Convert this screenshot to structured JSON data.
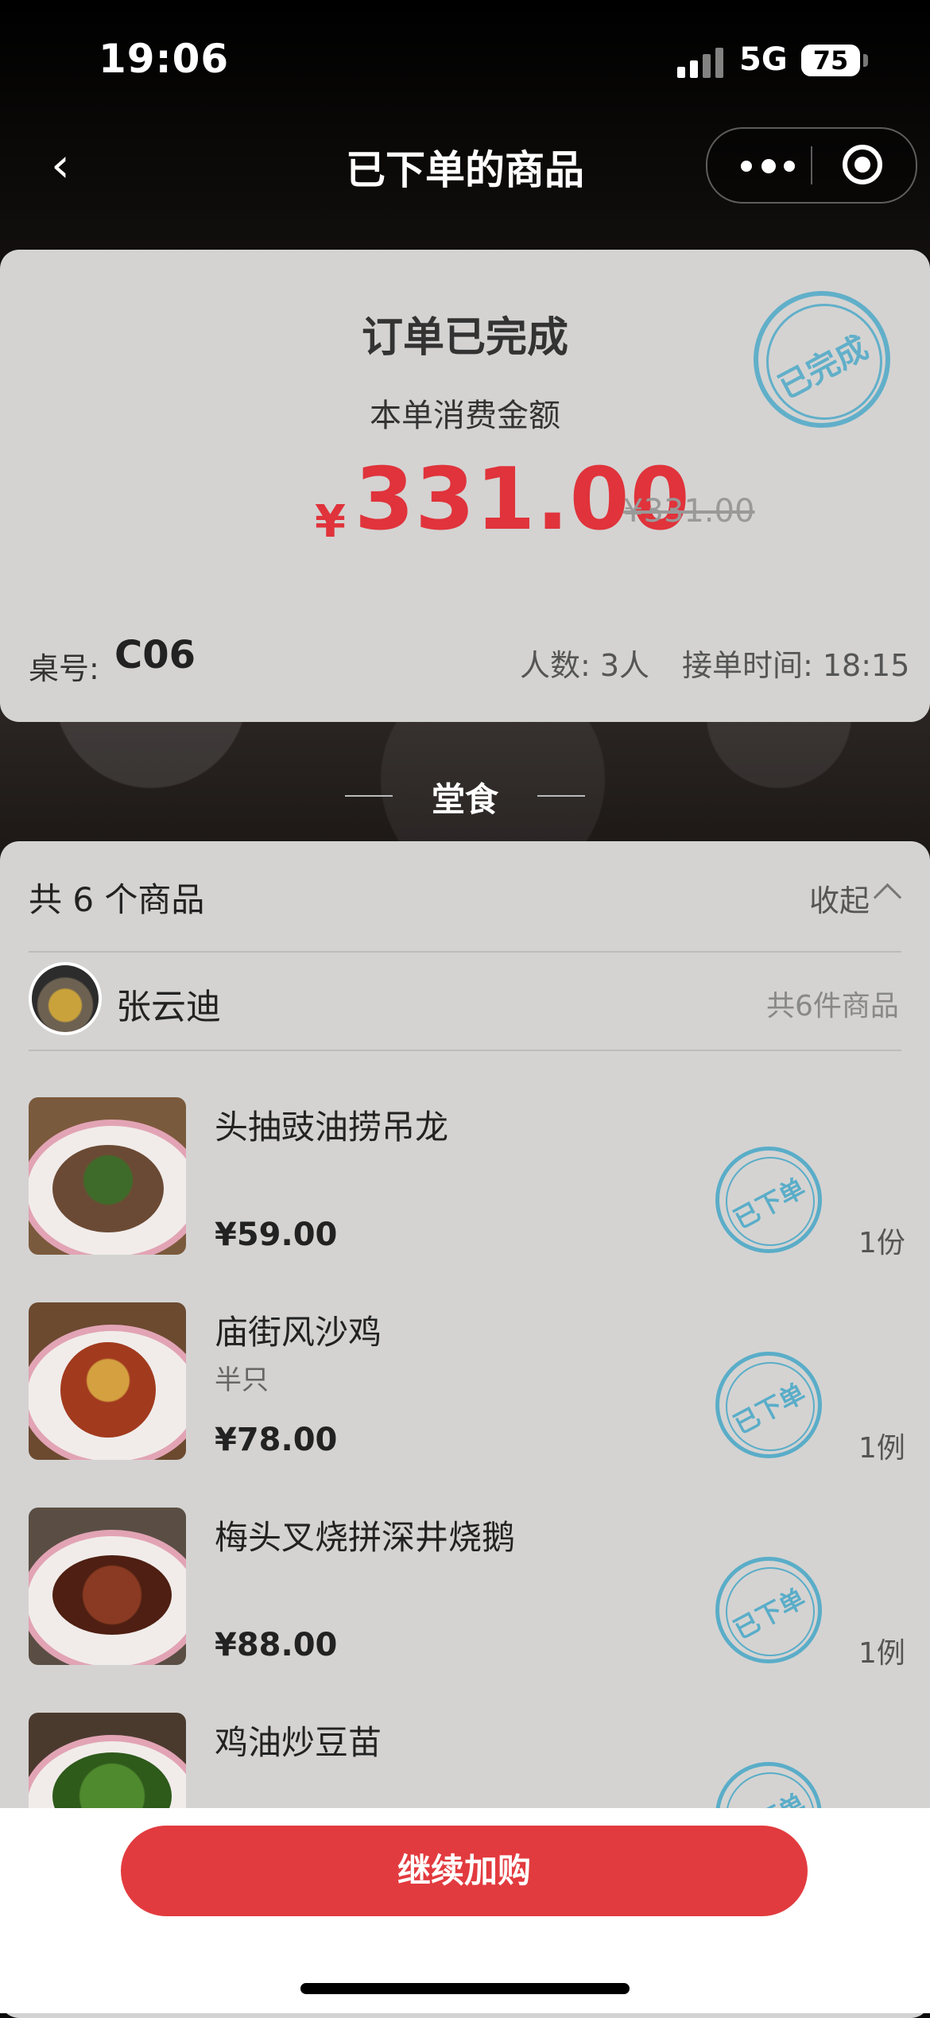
{
  "status_bar": {
    "time": "19:06",
    "network": "5G",
    "battery": "75"
  },
  "nav": {
    "title": "已下单的商品"
  },
  "order": {
    "status": "订单已完成",
    "stamp": "已完成",
    "amount_label": "本单消费金额",
    "currency": "¥",
    "amount": "331.00",
    "original_price": "¥331.00",
    "table_label": "桌号:",
    "table_no": "C06",
    "people": "人数: 3人",
    "accept_time": "接单时间: 18:15"
  },
  "dine_type": "堂食",
  "items_header": {
    "count": "共 6 个商品",
    "collapse": "收起"
  },
  "user": {
    "name": "张云迪",
    "count": "共6件商品"
  },
  "items": [
    {
      "name": "头抽豉油捞吊龙",
      "spec": "",
      "price": "¥59.00",
      "qty": "1份",
      "stamp": "已下单"
    },
    {
      "name": "庙街风沙鸡",
      "spec": "半只",
      "price": "¥78.00",
      "qty": "1例",
      "stamp": "已下单"
    },
    {
      "name": "梅头叉烧拼深井烧鹅",
      "spec": "",
      "price": "¥88.00",
      "qty": "1例",
      "stamp": "已下单"
    },
    {
      "name": "鸡油炒豆苗",
      "spec": "",
      "price": "",
      "qty": "",
      "stamp": "已下单"
    }
  ],
  "bottom": {
    "button": "继续加购"
  }
}
